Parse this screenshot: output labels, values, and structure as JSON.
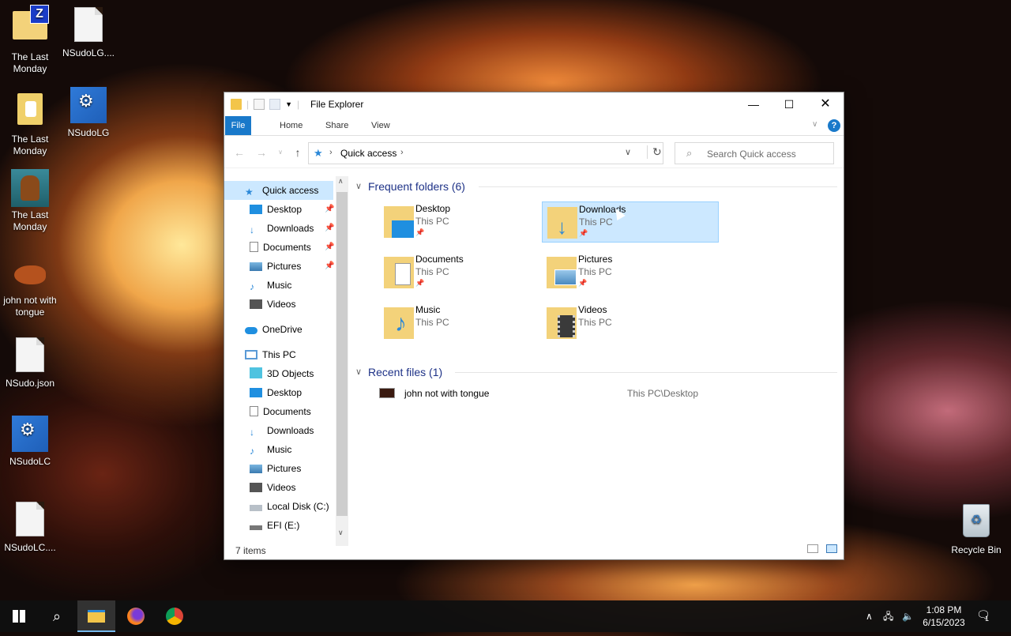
{
  "desktop": {
    "icons": [
      {
        "label": "The Last\nMonday"
      },
      {
        "label": "NSudoLG...."
      },
      {
        "label": "The Last\nMonday"
      },
      {
        "label": "NSudoLG"
      },
      {
        "label": "The Last\nMonday"
      },
      {
        "label": "john not with\ntongue"
      },
      {
        "label": "NSudo.json"
      },
      {
        "label": "NSudoLC"
      },
      {
        "label": "NSudoLC...."
      },
      {
        "label": "Recycle Bin"
      }
    ]
  },
  "window": {
    "title": "File Explorer",
    "ribbon_tabs": [
      "File",
      "Home",
      "Share",
      "View"
    ],
    "address": {
      "root": "Quick access"
    },
    "search_placeholder": "Search Quick access",
    "nav": {
      "quick_access": "Quick access",
      "qa_items": [
        "Desktop",
        "Downloads",
        "Documents",
        "Pictures",
        "Music",
        "Videos"
      ],
      "onedrive": "OneDrive",
      "this_pc": "This PC",
      "pc_items": [
        "3D Objects",
        "Desktop",
        "Documents",
        "Downloads",
        "Music",
        "Pictures",
        "Videos",
        "Local Disk (C:)",
        "EFI (E:)"
      ]
    },
    "frequent": {
      "heading": "Frequent folders (6)",
      "folders": [
        {
          "name": "Desktop",
          "location": "This PC",
          "pinned": true
        },
        {
          "name": "Downloads",
          "location": "This PC",
          "pinned": true,
          "selected": true
        },
        {
          "name": "Documents",
          "location": "This PC",
          "pinned": true
        },
        {
          "name": "Pictures",
          "location": "This PC",
          "pinned": true
        },
        {
          "name": "Music",
          "location": "This PC",
          "pinned": false
        },
        {
          "name": "Videos",
          "location": "This PC",
          "pinned": false
        }
      ]
    },
    "recent": {
      "heading": "Recent files (1)",
      "files": [
        {
          "name": "john not with tongue",
          "path": "This PC\\Desktop"
        }
      ]
    },
    "status": "7 items"
  },
  "taskbar": {
    "time": "1:08 PM",
    "date": "6/15/2023",
    "notification_count": "1"
  },
  "colors": {
    "accent": "#1979ca",
    "selection": "#cce8ff"
  }
}
